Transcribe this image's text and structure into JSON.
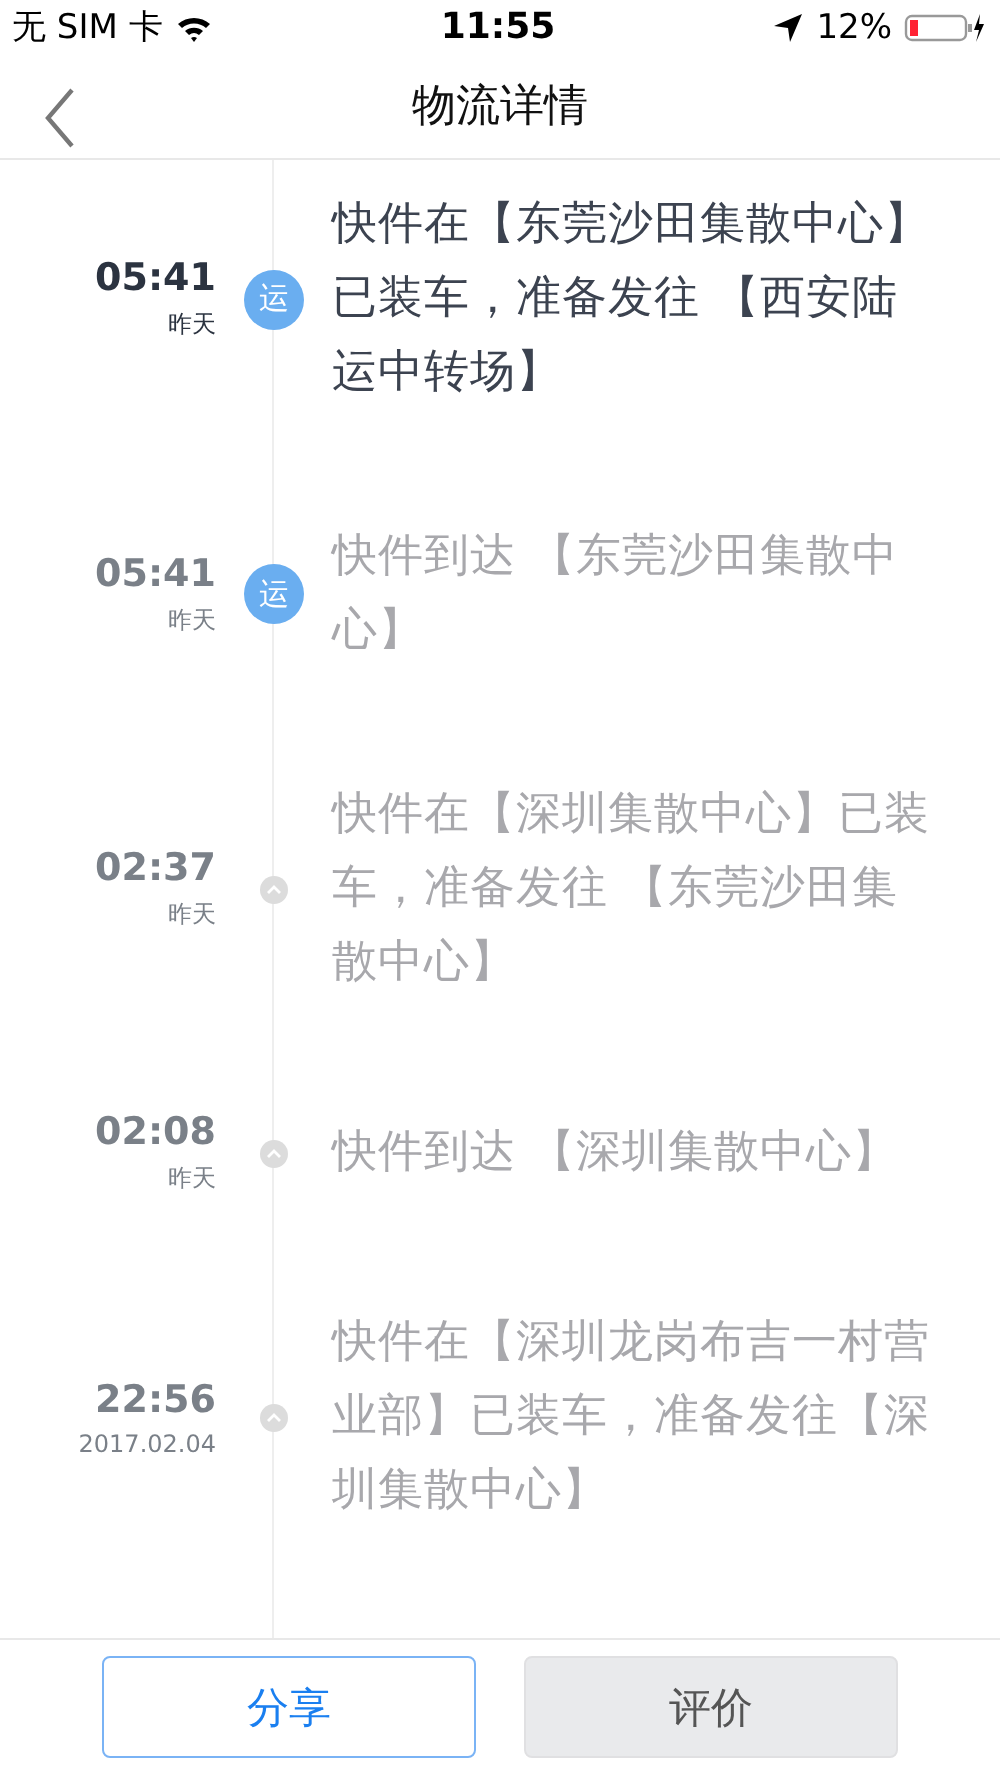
{
  "status_bar": {
    "carrier": "无 SIM 卡",
    "time": "11:55",
    "battery": "12%"
  },
  "nav": {
    "title": "物流详情"
  },
  "events": [
    {
      "kind": "transit",
      "badge": "运",
      "current": true,
      "time": "05:41",
      "date": "昨天",
      "text": "快件在【东莞沙田集散中心】已装车，准备发往 【西安陆运中转场】"
    },
    {
      "kind": "transit",
      "badge": "运",
      "current": false,
      "time": "05:41",
      "date": "昨天",
      "text": "快件到达 【东莞沙田集散中心】"
    },
    {
      "kind": "dot",
      "current": false,
      "time": "02:37",
      "date": "昨天",
      "text": "快件在【深圳集散中心】已装车，准备发往 【东莞沙田集散中心】"
    },
    {
      "kind": "dot",
      "current": false,
      "time": "02:08",
      "date": "昨天",
      "text": "快件到达 【深圳集散中心】"
    },
    {
      "kind": "dot",
      "current": false,
      "time": "22:56",
      "date": "2017.02.04",
      "text": "快件在【深圳龙岗布吉一村营业部】已装车，准备发往【深圳集散中心】"
    }
  ],
  "buttons": [
    {
      "kind": "primary",
      "label": "分享"
    },
    {
      "kind": "secondary",
      "label": "评价"
    }
  ]
}
